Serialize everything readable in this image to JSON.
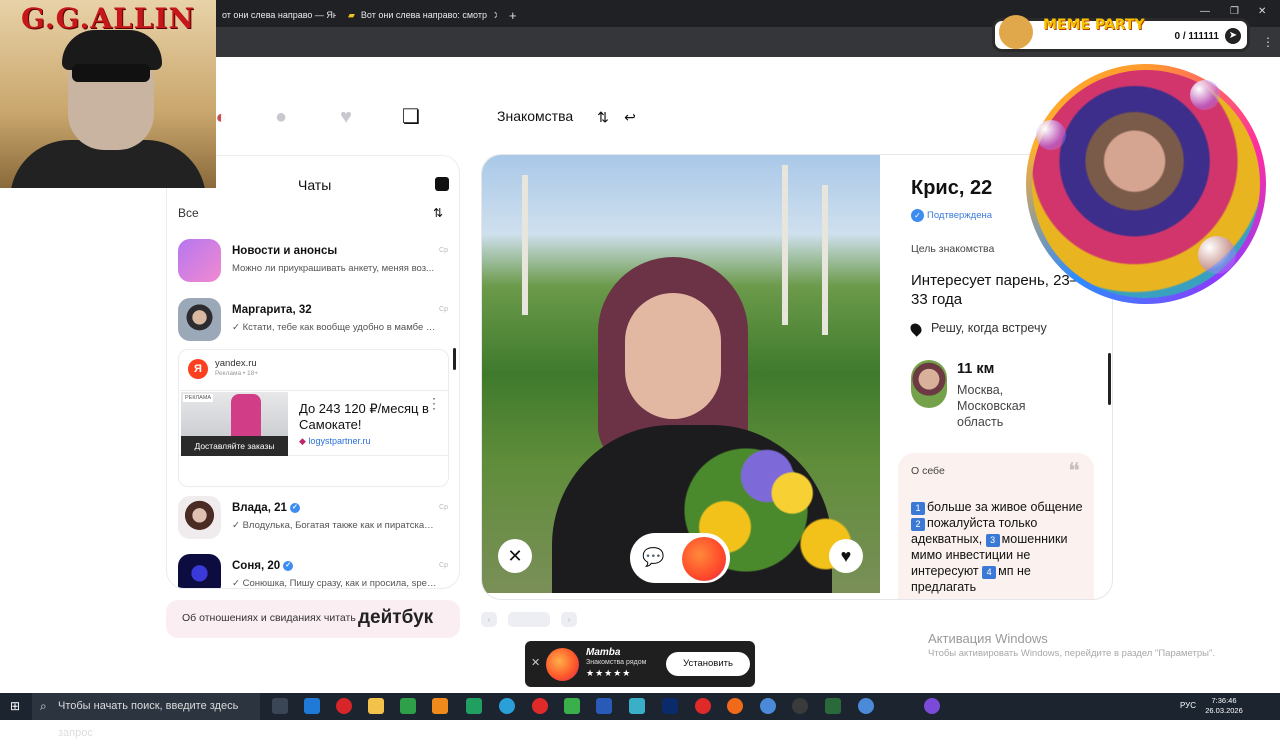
{
  "browser": {
    "tabs": [
      {
        "label": "от они слева направо — Янд",
        "active": false
      },
      {
        "label": "Вот они слева направо: смотр",
        "active": false
      }
    ],
    "new_tab": "+",
    "win_minimize": "—",
    "win_restore": "❐",
    "win_close": "✕"
  },
  "overlays": {
    "gg_title": "G.G.ALLIN",
    "meme_party": "MEME PARTY",
    "meme_count": "0 / 111111"
  },
  "nav": {
    "section_label": "Знакомства",
    "icons": [
      "profile-icon",
      "search-icon",
      "likes-icon",
      "cards-icon",
      "filter-icon",
      "undo-icon"
    ]
  },
  "chats": {
    "title": "Чаты",
    "filter_label": "Все",
    "items": [
      {
        "name": "Новости и анонсы",
        "message": "Можно ли приукрашивать анкету, меняя воз...",
        "time": "Ср",
        "verified": false
      },
      {
        "name": "Маргарита, 32",
        "message": "✓ Кстати, тебе как вообще удобно в мамбе о...",
        "time": "Ср",
        "verified": false
      },
      {
        "name": "Влада, 21",
        "message": "✓ Влодулька, Богатая также как и пиратская ...",
        "time": "Ср",
        "verified": true
      },
      {
        "name": "Соня, 20",
        "message": "✓ Сонюшка, Пишу сразу, как и просила, spec...",
        "time": "Ср",
        "verified": true
      }
    ],
    "ad": {
      "domain": "yandex.ru",
      "sub": "Реклама • 18+",
      "logo": "Я",
      "badge": "РЕКЛАМА",
      "cta": "Доставляйте заказы",
      "title": "До 243 120 ₽/месяц в Самокате!",
      "link": "logystpartner.ru"
    }
  },
  "datebook": {
    "text": "Об отношениях и свиданиях читать",
    "logo": "дейтбук"
  },
  "profile": {
    "name": "Крис, 22",
    "verified": "Подтверждена",
    "goal_label": "Цель знакомства",
    "goal": "Интересует парень, 23–33 года",
    "meet": "Решу, когда встречу",
    "distance": "11 км",
    "city": "Москва, Московская область",
    "about_label": "О себе",
    "about_parts": [
      {
        "num": "1",
        "text": "больше за живое общение"
      },
      {
        "num": "2",
        "text": "пожалуйста только адекватных,"
      },
      {
        "num": "3",
        "text": "мошенники мимо инвестиции не интересуют"
      },
      {
        "num": "4",
        "text": "мп не предлагать"
      }
    ],
    "buttons": {
      "dislike": "✕",
      "chat": "chat-icon",
      "like": "♥"
    }
  },
  "pager": {
    "prev": "‹",
    "next": "›"
  },
  "mamba": {
    "close": "✕",
    "name": "Mamba",
    "sub": "Знакомства рядом",
    "stars": "★★★★★",
    "install": "Установить"
  },
  "activation": {
    "title": "Активация Windows",
    "sub": "Чтобы активировать Windows, перейдите в раздел \"Параметры\"."
  },
  "taskbar": {
    "search_placeholder": "Чтобы начать поиск, введите здесь запрос",
    "lang": "РУС",
    "time": "7:36:46",
    "date": "26.03.2026"
  },
  "colors": {
    "accent": "#3d8cf0",
    "brand": "#ff4a2a",
    "ad_red": "#fc3f1d"
  }
}
